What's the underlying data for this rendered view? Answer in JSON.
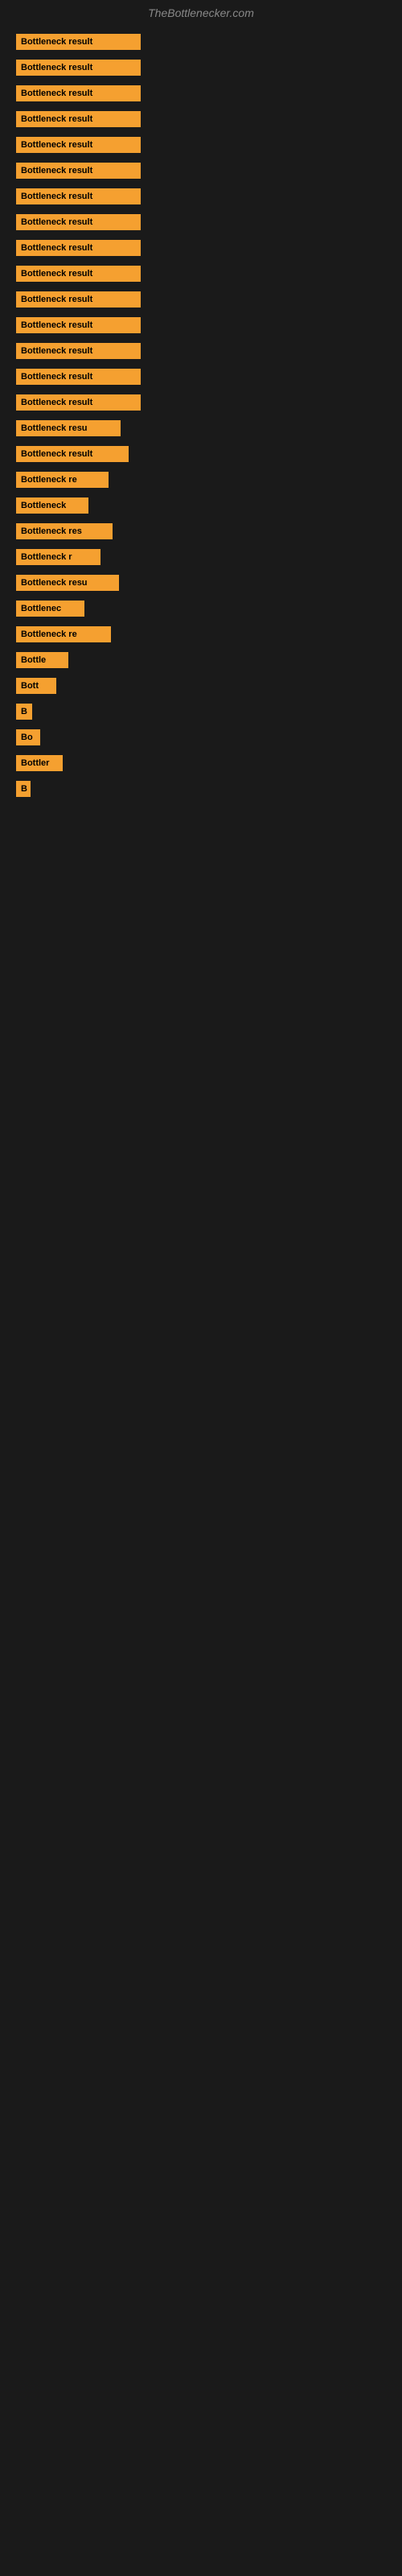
{
  "site": {
    "title": "TheBottlenecker.com"
  },
  "bars": [
    {
      "label": "Bottleneck result",
      "width": 155
    },
    {
      "label": "Bottleneck result",
      "width": 155
    },
    {
      "label": "Bottleneck result",
      "width": 155
    },
    {
      "label": "Bottleneck result",
      "width": 155
    },
    {
      "label": "Bottleneck result",
      "width": 155
    },
    {
      "label": "Bottleneck result",
      "width": 155
    },
    {
      "label": "Bottleneck result",
      "width": 155
    },
    {
      "label": "Bottleneck result",
      "width": 155
    },
    {
      "label": "Bottleneck result",
      "width": 155
    },
    {
      "label": "Bottleneck result",
      "width": 155
    },
    {
      "label": "Bottleneck result",
      "width": 155
    },
    {
      "label": "Bottleneck result",
      "width": 155
    },
    {
      "label": "Bottleneck result",
      "width": 155
    },
    {
      "label": "Bottleneck result",
      "width": 155
    },
    {
      "label": "Bottleneck result",
      "width": 155
    },
    {
      "label": "Bottleneck resu",
      "width": 130
    },
    {
      "label": "Bottleneck result",
      "width": 140
    },
    {
      "label": "Bottleneck re",
      "width": 115
    },
    {
      "label": "Bottleneck",
      "width": 90
    },
    {
      "label": "Bottleneck res",
      "width": 120
    },
    {
      "label": "Bottleneck r",
      "width": 105
    },
    {
      "label": "Bottleneck resu",
      "width": 128
    },
    {
      "label": "Bottlenec",
      "width": 85
    },
    {
      "label": "Bottleneck re",
      "width": 118
    },
    {
      "label": "Bottle",
      "width": 65
    },
    {
      "label": "Bott",
      "width": 50
    },
    {
      "label": "B",
      "width": 20
    },
    {
      "label": "Bo",
      "width": 30
    },
    {
      "label": "Bottler",
      "width": 58
    },
    {
      "label": "B",
      "width": 18
    }
  ]
}
